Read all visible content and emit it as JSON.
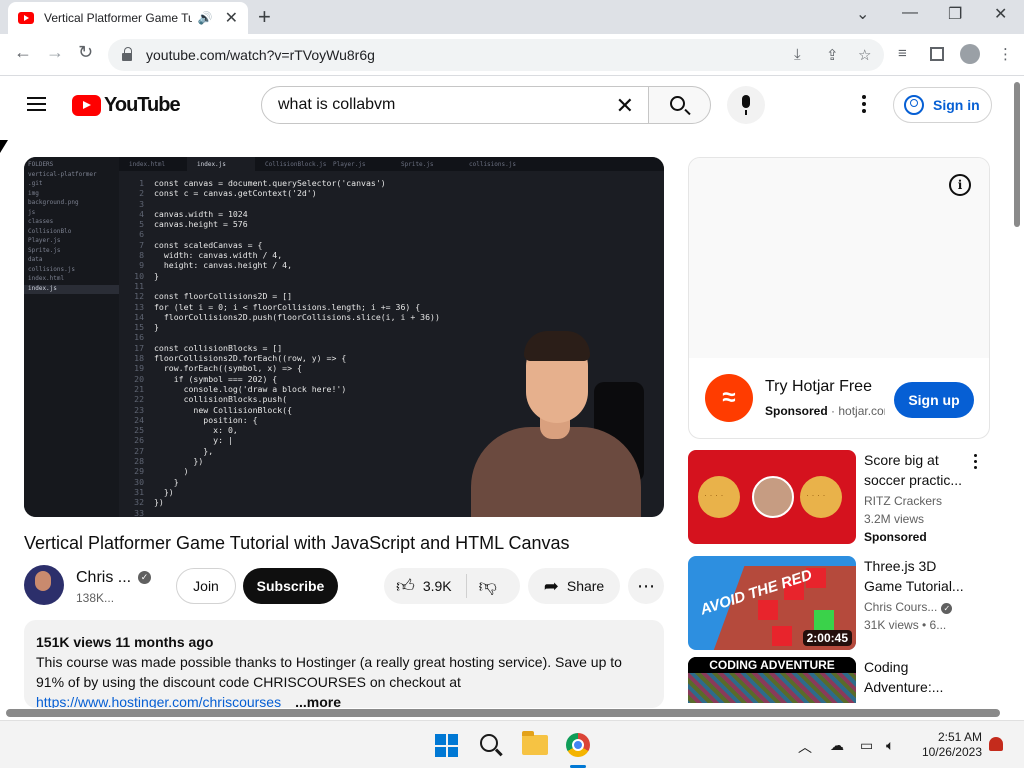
{
  "browser": {
    "tab_title": "Vertical Platformer Game Tu",
    "url": "youtube.com/watch?v=rTVoyWu8r6g",
    "new_tab_glyph": "+",
    "tab_close_glyph": "✕",
    "minimize_glyph": "—",
    "restore_glyph": "❐",
    "close_glyph": "✕",
    "chevron_glyph": "⌄"
  },
  "masthead": {
    "logo_text": "YouTube",
    "search_value": "what is collabvm",
    "sign_in": "Sign in"
  },
  "player": {
    "tabs": [
      "index.html",
      "index.js",
      "CollisionBlock.js",
      "Player.js",
      "Sprite.js",
      "collisions.js"
    ],
    "sidebar": [
      "FOLDERS",
      "vertical-platformer",
      "  .git",
      "  img",
      "    background.png",
      "  js",
      "    classes",
      "      CollisionBlo",
      "      Player.js",
      "      Sprite.js",
      "    data",
      "      collisions.js",
      "  index.html",
      "  index.js"
    ],
    "line_numbers": [
      "1",
      "2",
      "3",
      "4",
      "5",
      "6",
      "7",
      "8",
      "9",
      "10",
      "11",
      "12",
      "13",
      "14",
      "15",
      "16",
      "17",
      "18",
      "19",
      "20",
      "21",
      "22",
      "23",
      "24",
      "25",
      "26",
      "27",
      "28",
      "29",
      "30",
      "31",
      "32",
      "33"
    ],
    "code_lines": [
      "const canvas = document.querySelector('canvas')",
      "const c = canvas.getContext('2d')",
      "",
      "canvas.width = 1024",
      "canvas.height = 576",
      "",
      "const scaledCanvas = {",
      "  width: canvas.width / 4,",
      "  height: canvas.height / 4,",
      "}",
      "",
      "const floorCollisions2D = []",
      "for (let i = 0; i < floorCollisions.length; i += 36) {",
      "  floorCollisions2D.push(floorCollisions.slice(i, i + 36))",
      "}",
      "",
      "const collisionBlocks = []",
      "floorCollisions2D.forEach((row, y) => {",
      "  row.forEach((symbol, x) => {",
      "    if (symbol === 202) {",
      "      console.log('draw a block here!')",
      "      collisionBlocks.push(",
      "        new CollisionBlock({",
      "          position: {",
      "            x: 0,",
      "            y: |",
      "          },",
      "        })",
      "      )",
      "    }",
      "  })",
      "})",
      ""
    ]
  },
  "video": {
    "title": "Vertical Platformer Game Tutorial with JavaScript and HTML Canvas",
    "channel": "Chris ...",
    "subs": "138K...",
    "join": "Join",
    "subscribe": "Subscribe",
    "likes": "3.9K",
    "share": "Share",
    "views_date": "151K views  11 months ago",
    "description_1": "This course was made possible thanks to Hostinger (a really great hosting service). Save up to 91% of by using the discount code CHRISCOURSES on checkout at",
    "description_link": "https://www.hostinger.com/chriscourses",
    "more": "...more"
  },
  "ad": {
    "title": "Try Hotjar Free",
    "sponsored": "Sponsored",
    "domain": "hotjar.com",
    "cta": "Sign up",
    "logo_glyph": "≈"
  },
  "recommendations": [
    {
      "title": "Score big at soccer practic...",
      "channel": "RITZ Crackers",
      "views": "3.2M views",
      "badge": "Sponsored",
      "duration": ""
    },
    {
      "title": "Three.js 3D Game Tutorial...",
      "channel": "Chris Cours...",
      "views": "31K views • 6...",
      "badge": "",
      "duration": "2:00:45",
      "thumb_text": "AVOID THE RED"
    },
    {
      "title": "Coding Adventure:...",
      "channel": "",
      "views": "",
      "badge": "",
      "duration": "",
      "thumb_text": "CODING ADVENTURE"
    }
  ],
  "taskbar": {
    "time": "2:51 AM",
    "date": "10/26/2023",
    "tray_chevron": "︿"
  },
  "colors": {
    "yt_red": "#ff0000",
    "link_blue": "#065fd4",
    "windows_blue": "#0078d4"
  }
}
